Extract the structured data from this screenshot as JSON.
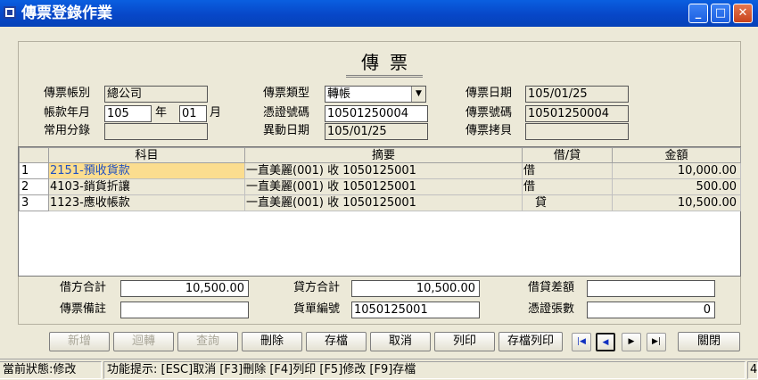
{
  "window": {
    "title": "傳票登錄作業",
    "min": "_",
    "max": "□",
    "close": "✕"
  },
  "heading": "傳票",
  "form": {
    "account_label": "傳票帳別",
    "account_value": "總公司",
    "period_label": "帳款年月",
    "year_value": "105",
    "year_unit": "年",
    "month_value": "01",
    "month_unit": "月",
    "common_label": "常用分錄",
    "common_value": "",
    "type_label": "傳票類型",
    "type_value": "轉帳",
    "voucher_no_label": "憑證號碼",
    "voucher_no_value": "10501250004",
    "change_date_label": "異動日期",
    "change_date_value": "105/01/25",
    "date_label": "傳票日期",
    "date_value": "105/01/25",
    "ticket_no_label": "傳票號碼",
    "ticket_no_value": "10501250004",
    "copier_label": "傳票拷貝",
    "copier_value": ""
  },
  "grid": {
    "headers": [
      "科目",
      "摘要",
      "借/貸",
      "金額"
    ],
    "rows": [
      {
        "n": "1",
        "subject": "2151-預收貨款",
        "summary": "一直美麗(001) 收 1050125001",
        "dc": "借",
        "amount": "10,000.00"
      },
      {
        "n": "2",
        "subject": "4103-銷貨折讓",
        "summary": "一直美麗(001) 收 1050125001",
        "dc": "借",
        "amount": "500.00"
      },
      {
        "n": "3",
        "subject": "1123-應收帳款",
        "summary": "一直美麗(001) 收 1050125001",
        "dc": "　貸",
        "amount": "10,500.00"
      }
    ]
  },
  "totals": {
    "debit_label": "借方合計",
    "debit_value": "10,500.00",
    "credit_label": "貸方合計",
    "credit_value": "10,500.00",
    "diff_label": "借貸差額",
    "diff_value": "",
    "note_label": "傳票備註",
    "note_value": "",
    "bill_label": "貨單編號",
    "bill_value": "1050125001",
    "count_label": "憑證張數",
    "count_value": "0"
  },
  "buttons": {
    "add": "新增",
    "rollover": "迴轉",
    "query": "查詢",
    "delete": "刪除",
    "save": "存檔",
    "cancel": "取消",
    "print": "列印",
    "save_print": "存檔列印",
    "close": "關閉"
  },
  "nav": {
    "first": "|◀",
    "prev": "◀",
    "next": "▶",
    "last": "▶|"
  },
  "status": {
    "state": "當前狀態:修改",
    "hint": "功能提示: [ESC]取消 [F3]刪除 [F4]列印 [F5]修改 [F9]存檔",
    "count": "4"
  }
}
